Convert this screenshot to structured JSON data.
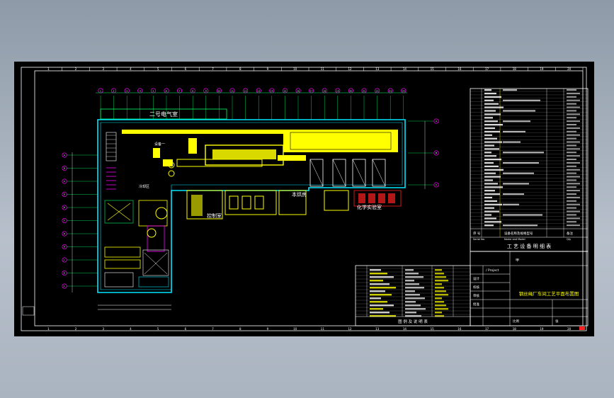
{
  "drawing": {
    "electrical_room_label": "二号电气室",
    "drying_room_label": "本烘房",
    "control_room_label": "控制室",
    "analysis_room_label": "化学实验室",
    "detail_label_a": "设备一",
    "detail_label_b": "冷却区",
    "axis_letters": [
      "A",
      "B",
      "C",
      "D",
      "E",
      "F",
      "G",
      "H",
      "J",
      "K",
      "L"
    ],
    "axis_numbers": [
      "1",
      "2",
      "3",
      "4",
      "5",
      "6",
      "7",
      "8",
      "9",
      "10",
      "11",
      "12",
      "13",
      "14",
      "15",
      "16",
      "17",
      "18",
      "19",
      "20",
      "21",
      "22",
      "23",
      "24"
    ],
    "frame_numbers": [
      "1",
      "2",
      "3",
      "4",
      "5",
      "6",
      "7",
      "8",
      "9",
      "10",
      "11",
      "12",
      "13",
      "14",
      "15",
      "16",
      "17",
      "18",
      "19",
      "20"
    ]
  },
  "title_block": {
    "equipment_table_title": "工 艺 设 备 明 细 表",
    "equipment_header_no": "序 号",
    "equipment_header_code": "设备名称及规格型号",
    "equipment_header_remark": "备注",
    "equipment_header_en": "Serial No.",
    "equipment_header_en2": "Name and Model",
    "equipment_header_en3": "Qty",
    "project_label": "/ Project",
    "design_label": "设计",
    "check_label": "校核",
    "review_label": "审核",
    "approve_label": "批准",
    "drawing_title": "钢丝绳厂车间工艺平面布置图",
    "scale_label": "比例",
    "sheet_label": "张",
    "sub_table_title": "图 例 及 说 明 表",
    "stamp": "甲"
  },
  "colors": {
    "frame": "#ffffff",
    "wall": "#00e5ff",
    "equipment": "#ffff00",
    "accent": "#ff00ff",
    "green": "#00ff66",
    "red": "#ff2020"
  }
}
